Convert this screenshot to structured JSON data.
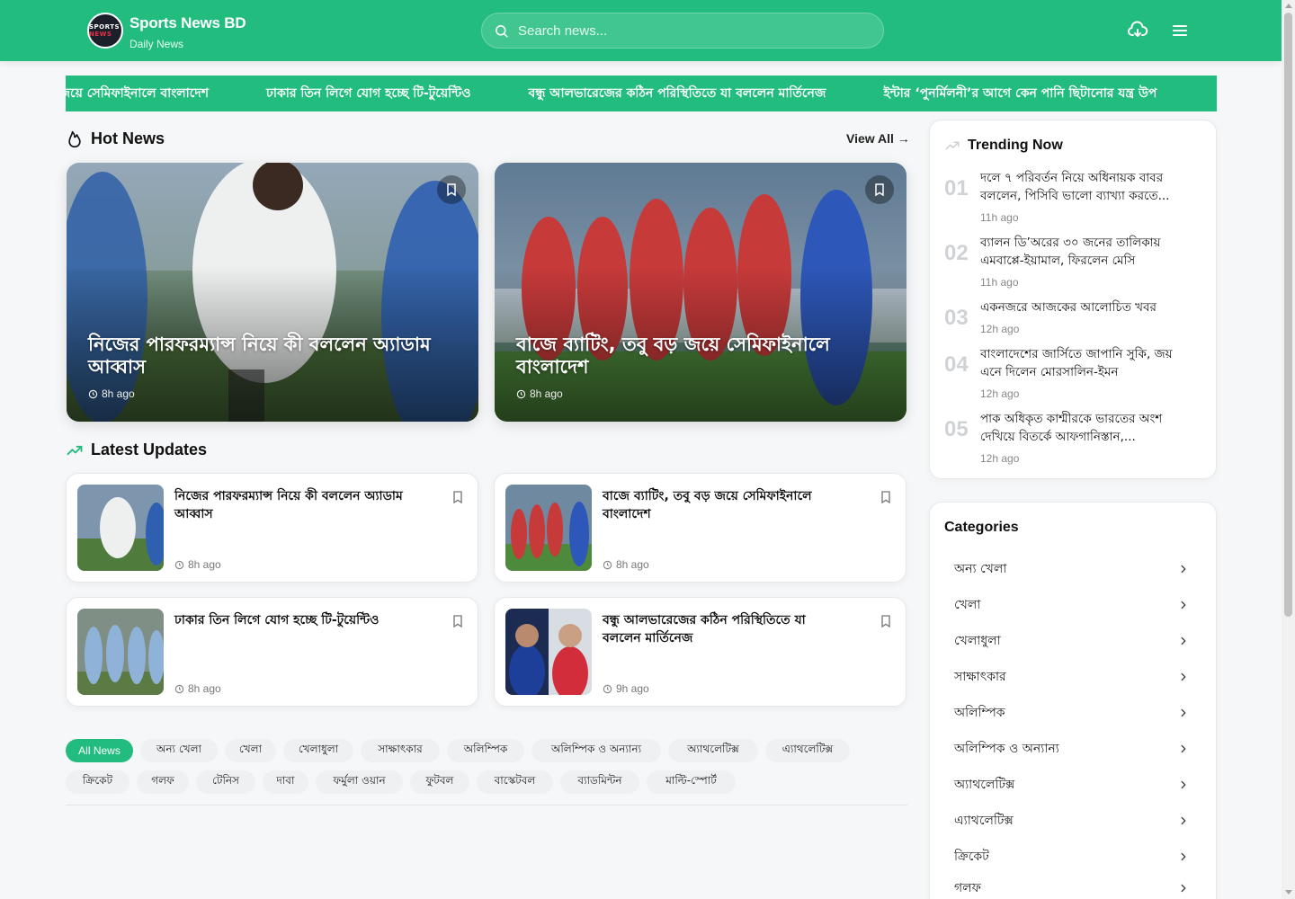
{
  "brand": {
    "title": "Sports News BD",
    "subtitle": "Daily News"
  },
  "search": {
    "placeholder": "Search news..."
  },
  "ticker": [
    "বাজে ব্যাটিং, তবু বড় জয়ে সেমিফাইনালে বাংলাদেশ",
    "ঢাকার তিন লিগে যোগ হচ্ছে টি-টুয়েন্টিও",
    "বন্ধু আলভারেজের কঠিন পরিস্থিতিতে যা বললেন মার্তিনেজ",
    "ইন্টার ‘পুনর্মিলনী’র আগে কেন পানি ছিটানোর যন্ত্র উপ"
  ],
  "hot_news": {
    "heading": "Hot News",
    "view_all": "View All →",
    "cards": [
      {
        "title": "নিজের পারফরম্যান্স নিয়ে কী বললেন অ্যাডাম আব্বাস",
        "time": "8h ago"
      },
      {
        "title": "বাজে ব্যাটিং, তবু বড় জয়ে সেমিফাইনালে বাংলাদেশ",
        "time": "8h ago"
      }
    ]
  },
  "latest": {
    "heading": "Latest Updates",
    "cards": [
      {
        "title": "নিজের পারফরম্যান্স নিয়ে কী বললেন অ্যাডাম আব্বাস",
        "time": "8h ago"
      },
      {
        "title": "বাজে ব্যাটিং, তবু বড় জয়ে সেমিফাইনালে বাংলাদেশ",
        "time": "8h ago"
      },
      {
        "title": "ঢাকার তিন লিগে যোগ হচ্ছে টি-টুয়েন্টিও",
        "time": "8h ago"
      },
      {
        "title": "বন্ধু আলভারেজের কঠিন পরিস্থিতিতে যা বললেন মার্তিনেজ",
        "time": "9h ago"
      }
    ]
  },
  "filters": [
    "All News",
    "অন্য খেলা",
    "খেলা",
    "খেলাধুলা",
    "সাক্ষাৎকার",
    "অলিম্পিক",
    "অলিম্পিক ও অন্যান্য",
    "অ্যাথলেটিক্স",
    "এ্যাথলেটিক্স",
    "ক্রিকেট",
    "গলফ",
    "টেনিস",
    "দাবা",
    "ফর্মুলা ওয়ান",
    "ফুটবল",
    "বাস্কেটবল",
    "ব্যাডমিন্টন",
    "মাল্টি-স্পোর্ট"
  ],
  "trending": {
    "heading": "Trending Now",
    "items": [
      {
        "num": "01",
        "title": "দলে ৭ পরিবর্তন নিয়ে অধিনায়ক বাবর বললেন, পিসিবি ভালো ব্যাখ্যা করতে...",
        "time": "11h ago"
      },
      {
        "num": "02",
        "title": "ব্যালন ডি’অরের ৩০ জনের তালিকায় এমবাপ্পে-ইয়ামাল, ফিরলেন মেসি",
        "time": "11h ago"
      },
      {
        "num": "03",
        "title": "একনজরে আজকের আলোচিত খবর",
        "time": "12h ago"
      },
      {
        "num": "04",
        "title": "বাংলাদেশের জার্সিতে জাপানি সুকি, জয় এনে দিলেন মোরসালিন-ইমন",
        "time": "12h ago"
      },
      {
        "num": "05",
        "title": "পাক অধিকৃত কাশ্মীরকে ভারতের অংশ দেখিয়ে বিতর্কে আফগানিস্তান,...",
        "time": "12h ago"
      }
    ]
  },
  "categories": {
    "heading": "Categories",
    "items": [
      "অন্য খেলা",
      "খেলা",
      "খেলাধুলা",
      "সাক্ষাৎকার",
      "অলিম্পিক",
      "অলিম্পিক ও অন্যান্য",
      "অ্যাথলেটিক্স",
      "এ্যাথলেটিক্স",
      "ক্রিকেট",
      "গলফ"
    ]
  },
  "colors": {
    "accent": "#22bd7e",
    "text": "#111111",
    "muted": "#888888"
  },
  "icons": [
    "search-icon",
    "download-icon",
    "menu-icon",
    "fire-icon",
    "trending-icon",
    "bookmark-icon",
    "clock-icon",
    "chevron-right-icon"
  ]
}
